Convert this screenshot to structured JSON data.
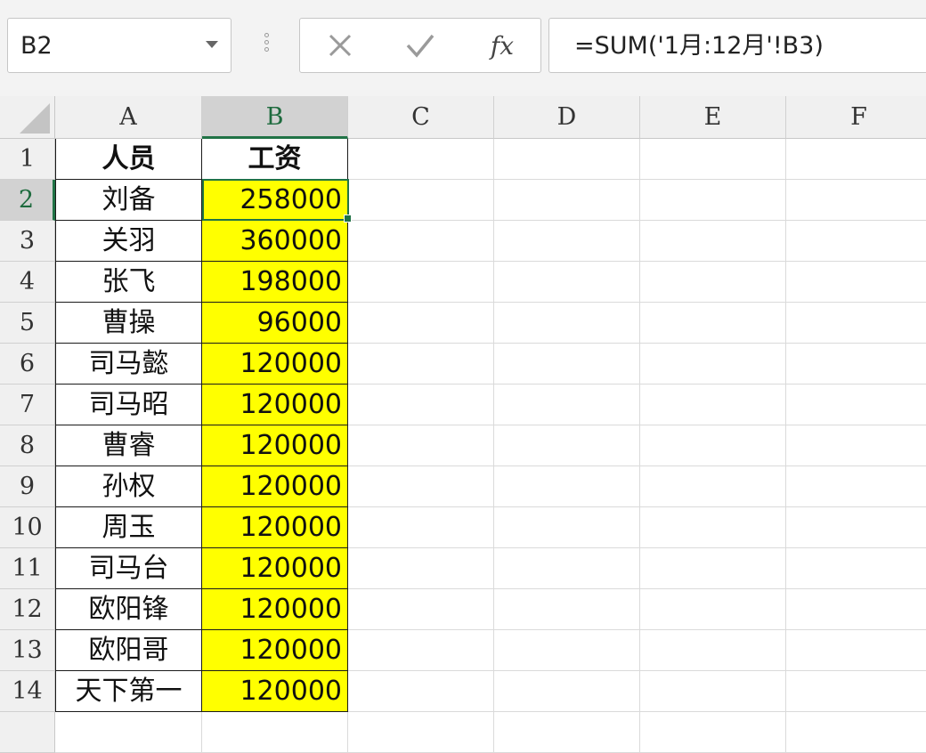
{
  "formula_bar": {
    "name_box": "B2",
    "formula": "=SUM('1月:12月'!B3)",
    "cancel_icon": "close-icon",
    "enter_icon": "check-icon",
    "fx_label": "fx"
  },
  "grid": {
    "columns": [
      "A",
      "B",
      "C",
      "D",
      "E",
      "F"
    ],
    "selected_column": "B",
    "selected_row": 2,
    "header": {
      "a": "人员",
      "b": "工资"
    },
    "rows": [
      {
        "num": "1"
      },
      {
        "num": "2",
        "a": "刘备",
        "b": "258000"
      },
      {
        "num": "3",
        "a": "关羽",
        "b": "360000"
      },
      {
        "num": "4",
        "a": "张飞",
        "b": "198000"
      },
      {
        "num": "5",
        "a": "曹操",
        "b": "96000"
      },
      {
        "num": "6",
        "a": "司马懿",
        "b": "120000"
      },
      {
        "num": "7",
        "a": "司马昭",
        "b": "120000"
      },
      {
        "num": "8",
        "a": "曹睿",
        "b": "120000"
      },
      {
        "num": "9",
        "a": "孙权",
        "b": "120000"
      },
      {
        "num": "10",
        "a": "周玉",
        "b": "120000"
      },
      {
        "num": "11",
        "a": "司马台",
        "b": "120000"
      },
      {
        "num": "12",
        "a": "欧阳锋",
        "b": "120000"
      },
      {
        "num": "13",
        "a": "欧阳哥",
        "b": "120000"
      },
      {
        "num": "14",
        "a": "天下第一",
        "b": "120000"
      }
    ],
    "highlight_color": "#ffff00",
    "selection_color": "#217346"
  }
}
